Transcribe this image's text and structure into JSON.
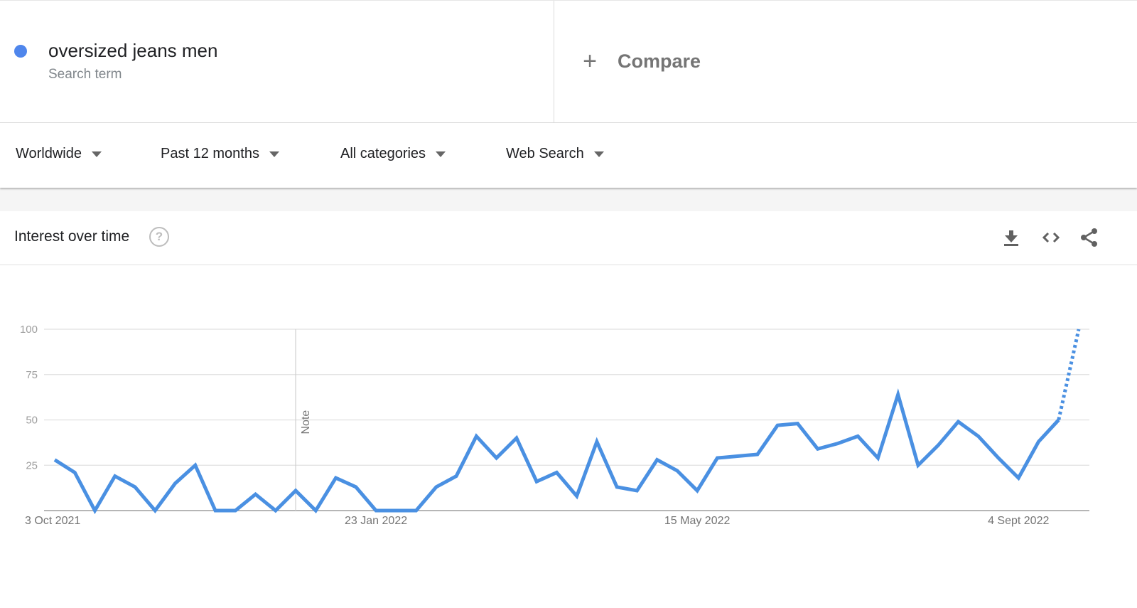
{
  "search_term": {
    "name": "oversized jeans men",
    "type": "Search term",
    "color": "#4f86ec"
  },
  "compare": {
    "icon": "plus-icon",
    "label": "Compare"
  },
  "filters": [
    {
      "label": "Worldwide"
    },
    {
      "label": "Past 12 months"
    },
    {
      "label": "All categories"
    },
    {
      "label": "Web Search"
    }
  ],
  "card": {
    "title": "Interest over time",
    "help_icon": "?",
    "tools": [
      "download-icon",
      "embed-code-icon",
      "share-icon"
    ]
  },
  "chart_data": {
    "type": "line",
    "title": "Interest over time",
    "xlabel": "",
    "ylabel": "",
    "ylim": [
      0,
      100
    ],
    "yticks": [
      25,
      50,
      75,
      100
    ],
    "grid": true,
    "x_tick_labels": [
      {
        "index": 0,
        "label": "3 Oct 2021"
      },
      {
        "index": 16,
        "label": "23 Jan 2022"
      },
      {
        "index": 32,
        "label": "15 May 2022"
      },
      {
        "index": 48,
        "label": "4 Sept 2022"
      }
    ],
    "annotation": {
      "index": 12,
      "label": "Note"
    },
    "series": [
      {
        "name": "oversized jeans men",
        "color": "#4a90e2",
        "values": [
          28,
          21,
          0,
          19,
          13,
          0,
          15,
          25,
          0,
          0,
          9,
          0,
          11,
          0,
          18,
          13,
          0,
          0,
          0,
          13,
          19,
          41,
          29,
          40,
          16,
          21,
          8,
          38,
          13,
          11,
          28,
          22,
          11,
          29,
          30,
          31,
          47,
          48,
          34,
          37,
          41,
          29,
          64,
          25,
          36,
          49,
          41,
          29,
          18,
          38,
          50,
          100
        ],
        "partial_from_index": 50
      }
    ]
  }
}
